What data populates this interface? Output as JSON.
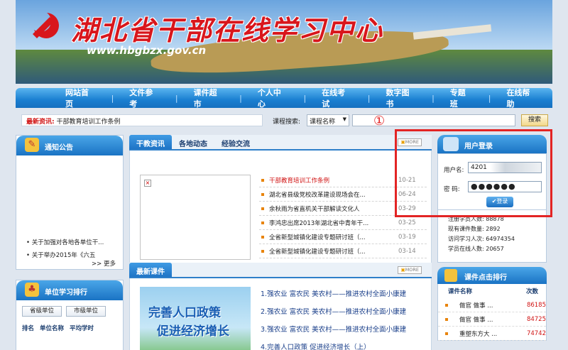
{
  "banner": {
    "title": "湖北省干部在线学习中心",
    "url": "www.hbgbzx.gov.cn"
  },
  "nav": [
    "网站首页",
    "文件参考",
    "课件超市",
    "个人中心",
    "在线考试",
    "数字图书",
    "专题班",
    "在线帮助"
  ],
  "ticker": {
    "label": "最新资讯:",
    "text": "干部教育培训工作条例"
  },
  "search": {
    "label": "课程搜索:",
    "option": "课程名称",
    "button": "搜索"
  },
  "notice": {
    "title": "通知公告",
    "items": [
      "关于加强对各地各单位干...",
      "关于举办2015年《六五"
    ],
    "more": ">> 更多"
  },
  "ranking": {
    "title": "单位学习排行",
    "tabs": [
      "省级单位",
      "市级单位"
    ],
    "columns": [
      "排名",
      "单位名称",
      "平均学时"
    ]
  },
  "news": {
    "tabs": [
      "干教资讯",
      "各地动态",
      "经验交流"
    ],
    "more": "MORE",
    "items": [
      {
        "title": "干部教育培训工作条例",
        "date": "10-21",
        "highlight": true
      },
      {
        "title": "湖北省县级党校改革建设现场会在...",
        "date": "06-24"
      },
      {
        "title": "余秋雨为省直机关干部解读文化人",
        "date": "03-29"
      },
      {
        "title": "李鸿忠出席2013年湖北省中青年干...",
        "date": "03-25"
      },
      {
        "title": "全省新型城镇化建设专题研讨班（...",
        "date": "03-19"
      },
      {
        "title": "全省新型城镇化建设专题研讨班（...",
        "date": "03-14"
      }
    ]
  },
  "courses": {
    "title": "最新课件",
    "more": "MORE",
    "promo": [
      "完善人口政策",
      "促进经济增长"
    ],
    "items": [
      "1.强农业 富农民 美农村——推进农村全面小康建",
      "2.强农业 富农民 美农村——推进农村全面小康建",
      "3.强农业 富农民 美农村——推进农村全面小康建",
      "4.完善人口政策  促进经济增长（上）"
    ]
  },
  "login": {
    "title": "用户登录",
    "user_label": "用户名:",
    "user_value": "4201",
    "pass_label": "密  码:",
    "pass_value": "●●●●●●",
    "button": "登录"
  },
  "stats": [
    "注册学员人数: 88878",
    "现有课件数量: 2892",
    "访问学习人次: 64974354",
    "学员在线人数: 20657"
  ],
  "hot": {
    "title": "课件点击排行",
    "columns": [
      "课件名称",
      "次数"
    ],
    "items": [
      {
        "name": "做官 做事 ...",
        "count": "86185"
      },
      {
        "name": "做官 做事 ...",
        "count": "84725"
      },
      {
        "name": "重塑东方大 ...",
        "count": "74742"
      }
    ]
  },
  "annotation": {
    "marker": "①",
    "color": "#e32424"
  }
}
